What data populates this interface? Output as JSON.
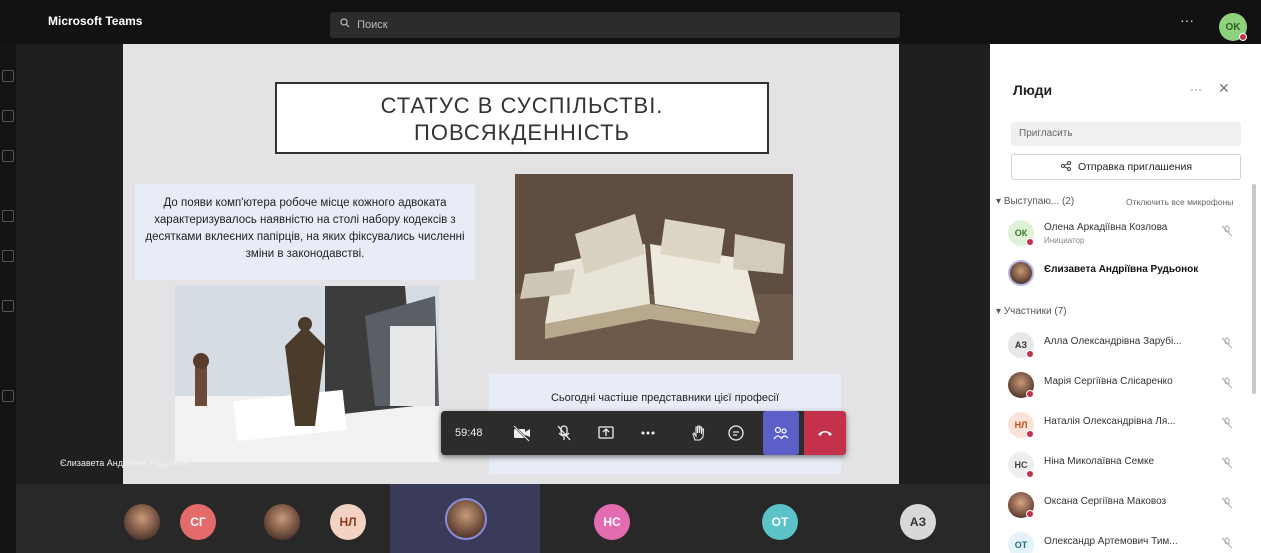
{
  "app": {
    "title": "Microsoft Teams",
    "search_placeholder": "Поиск",
    "user_initials": "OK"
  },
  "slide": {
    "title": "СТАТУС В СУСПІЛЬСТВІ. ПОВСЯКДЕННІСТЬ",
    "text1": "До появи комп'ютера робоче місце кожного адвоката характеризувалось наявністю на столі набору кодексів з десятками вклеєних папірців, на яких фіксувались численні зміни в законодавстві.",
    "text2": "Сьогодні частіше представники цієї професії"
  },
  "presenter_label": "Єлизавета Андріївна Рудьонок",
  "controls": {
    "timer": "59:48"
  },
  "strip": {
    "tiles": [
      {
        "initials": "",
        "photo": true
      },
      {
        "initials": "СГ",
        "bg": "#e36b6b",
        "fg": "#fff"
      },
      {
        "initials": "",
        "photo": true
      },
      {
        "initials": "НЛ",
        "bg": "#f2d2c3",
        "fg": "#8a3b1e"
      },
      {
        "initials": "",
        "photo": true,
        "active": true
      },
      {
        "initials": "НС",
        "bg": "#e36bb0",
        "fg": "#fff"
      },
      {
        "initials": "ОТ",
        "bg": "#5bc3c8",
        "fg": "#fff"
      },
      {
        "initials": "АЗ",
        "bg": "#d8d8d8",
        "fg": "#333"
      }
    ]
  },
  "panel": {
    "title": "Люди",
    "invite_placeholder": "Пригласить",
    "share_label": "Отправка приглашения",
    "presenters_label": "Выступаю... (2)",
    "mute_all_label": "Отключить все микрофоны",
    "participants_label": "Участники (7)",
    "presenters": [
      {
        "name": "Олена Аркадіївна Козлова",
        "sub": "Инициатор",
        "initials": "ОК",
        "bg": "#dff2d8",
        "fg": "#3a7a2a",
        "muted": true
      },
      {
        "name": "Єлизавета Андріївна Рудьонок",
        "sub": "",
        "initials": "",
        "photo": true,
        "bold": true,
        "muted": false
      }
    ],
    "participants": [
      {
        "name": "Алла Олександрівна Зарубі...",
        "initials": "АЗ",
        "bg": "#e8e8e8",
        "fg": "#333"
      },
      {
        "name": "Марія Сергіївна Слісаренко",
        "initials": "",
        "photo": true
      },
      {
        "name": "Наталія Олександрівна Ля...",
        "initials": "НЛ",
        "bg": "#fbe3d8",
        "fg": "#b3541e"
      },
      {
        "name": "Ніна Миколаївна Семке",
        "initials": "НС",
        "bg": "#eee",
        "fg": "#444"
      },
      {
        "name": "Оксана Сергіївна Маковоз",
        "initials": "",
        "photo": true
      },
      {
        "name": "Олександр Артемович Тим...",
        "initials": "ОТ",
        "bg": "#e4f3f7",
        "fg": "#1f6f85"
      }
    ]
  }
}
